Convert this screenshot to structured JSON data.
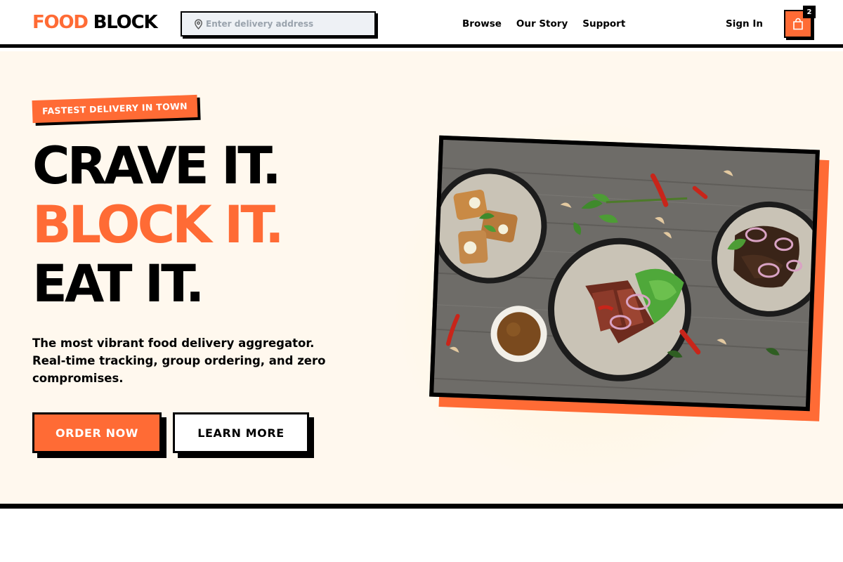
{
  "brand": {
    "part1": "FOOD",
    "part2": "BLOCK",
    "accent_color": "#ff6b35"
  },
  "search": {
    "placeholder": "Enter delivery address",
    "icon": "location-pin-icon"
  },
  "nav": {
    "links": [
      {
        "label": "Browse"
      },
      {
        "label": "Our Story"
      },
      {
        "label": "Support"
      }
    ],
    "signin_label": "Sign In",
    "cart": {
      "count": "2",
      "icon": "shopping-bag-icon"
    }
  },
  "hero": {
    "badge": "FASTEST DELIVERY IN TOWN",
    "headline": [
      "CRAVE IT.",
      "BLOCK IT.",
      "EAT IT."
    ],
    "subtext": "The most vibrant food delivery aggregator. Real-time tracking, group ordering, and zero compromises.",
    "primary_button": "ORDER NOW",
    "secondary_button": "LEARN MORE",
    "image_alt": "food-bowls-photo"
  },
  "colors": {
    "accent": "#ff6b35",
    "ink": "#000000",
    "hero_bg": "#fff8ee"
  }
}
